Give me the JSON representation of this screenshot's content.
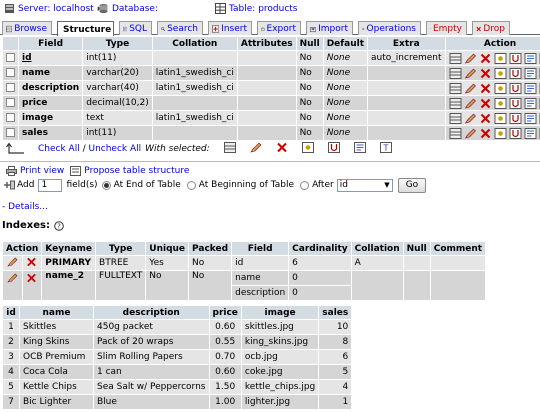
{
  "breadcrumb": {
    "server_label": "Server:",
    "server_value": "localhost",
    "database_label": "Database:",
    "table_label": "Table:",
    "table_value": "products"
  },
  "tabs": [
    {
      "label": "Browse"
    },
    {
      "label": "Structure"
    },
    {
      "label": "SQL"
    },
    {
      "label": "Search"
    },
    {
      "label": "Insert"
    },
    {
      "label": "Export"
    },
    {
      "label": "Import"
    },
    {
      "label": "Operations"
    },
    {
      "label": "Empty"
    },
    {
      "label": "Drop"
    }
  ],
  "structure": {
    "headers": [
      "Field",
      "Type",
      "Collation",
      "Attributes",
      "Null",
      "Default",
      "Extra",
      "Action"
    ],
    "rows": [
      {
        "field": "id",
        "type": "int(11)",
        "collation": "",
        "attributes": "",
        "null": "No",
        "default": "None",
        "extra": "auto_increment"
      },
      {
        "field": "name",
        "type": "varchar(20)",
        "collation": "latin1_swedish_ci",
        "attributes": "",
        "null": "No",
        "default": "None",
        "extra": ""
      },
      {
        "field": "description",
        "type": "varchar(40)",
        "collation": "latin1_swedish_ci",
        "attributes": "",
        "null": "No",
        "default": "None",
        "extra": ""
      },
      {
        "field": "price",
        "type": "decimal(10,2)",
        "collation": "",
        "attributes": "",
        "null": "No",
        "default": "None",
        "extra": ""
      },
      {
        "field": "image",
        "type": "text",
        "collation": "latin1_swedish_ci",
        "attributes": "",
        "null": "No",
        "default": "None",
        "extra": ""
      },
      {
        "field": "sales",
        "type": "int(11)",
        "collation": "",
        "attributes": "",
        "null": "No",
        "default": "None",
        "extra": ""
      }
    ],
    "check_all": "Check All",
    "uncheck_all": "Uncheck All",
    "slash": " / ",
    "with_selected": "With selected:"
  },
  "tools": {
    "print_view": "Print view",
    "propose": "Propose table structure",
    "add_label": "Add",
    "add_value": "1",
    "fields_label": "field(s)",
    "at_end": "At End of Table",
    "at_beginning": "At Beginning of Table",
    "after": "After",
    "after_value": "id",
    "go": "Go"
  },
  "details_link": "- Details...",
  "indexes": {
    "title": "Indexes:",
    "headers": [
      "Action",
      "Keyname",
      "Type",
      "Unique",
      "Packed",
      "Field",
      "Cardinality",
      "Collation",
      "Null",
      "Comment"
    ],
    "rows": [
      {
        "keyname": "PRIMARY",
        "type": "BTREE",
        "unique": "Yes",
        "packed": "No",
        "field": "id",
        "cardinality": "6",
        "collation": "A",
        "null": "",
        "comment": ""
      },
      {
        "keyname": "name_2",
        "type": "FULLTEXT",
        "unique": "No",
        "packed": "No",
        "field": "name",
        "cardinality": "0",
        "collation": "",
        "null": "",
        "comment": ""
      },
      {
        "keyname": "",
        "type": "",
        "unique": "",
        "packed": "",
        "field": "description",
        "cardinality": "0",
        "collation": "",
        "null": "",
        "comment": ""
      }
    ]
  },
  "data_table": {
    "headers": [
      "id",
      "name",
      "description",
      "price",
      "image",
      "sales"
    ],
    "rows": [
      {
        "id": "1",
        "name": "Skittles",
        "description": "450g packet",
        "price": "0.60",
        "image": "skittles.jpg",
        "sales": "10"
      },
      {
        "id": "2",
        "name": "King Skins",
        "description": "Pack of 20 wraps",
        "price": "0.55",
        "image": "king_skins.jpg",
        "sales": "8"
      },
      {
        "id": "3",
        "name": "OCB Premium",
        "description": "Slim Rolling Papers",
        "price": "0.70",
        "image": "ocb.jpg",
        "sales": "6"
      },
      {
        "id": "4",
        "name": "Coca Cola",
        "description": "1 can",
        "price": "0.60",
        "image": "coke.jpg",
        "sales": "5"
      },
      {
        "id": "5",
        "name": "Kettle Chips",
        "description": "Sea Salt w/ Peppercorns",
        "price": "1.50",
        "image": "kettle_chips.jpg",
        "sales": "4"
      },
      {
        "id": "7",
        "name": "Bic Lighter",
        "description": "Blue",
        "price": "1.00",
        "image": "lighter.jpg",
        "sales": "1"
      }
    ]
  },
  "colors": {
    "header_bg": "#d3dce3",
    "row_light": "#e5e5e5",
    "row_dark": "#d5d5d5",
    "link": "#0000ee",
    "danger": "#cc0000"
  }
}
